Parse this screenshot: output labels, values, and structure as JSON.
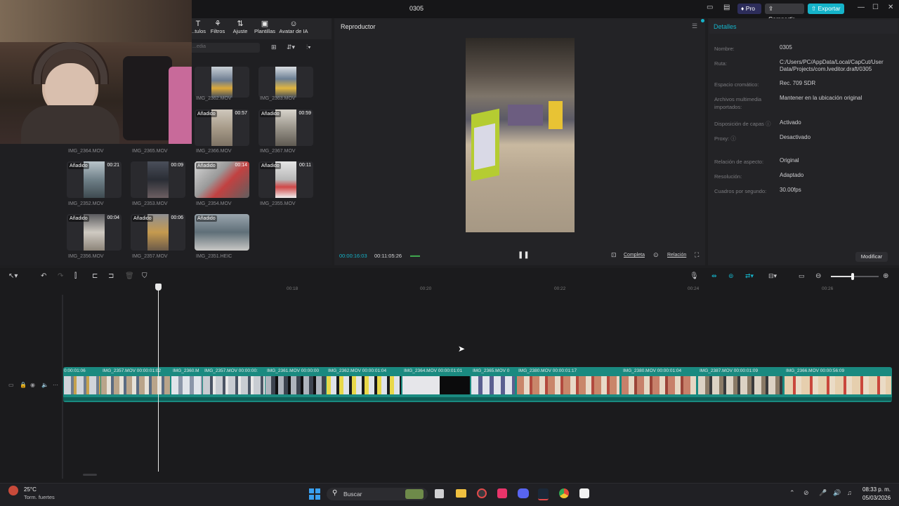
{
  "app": {
    "project_title": "0305",
    "pro_label": "Pro",
    "share_label": "Compartir",
    "export_label": "Exportar",
    "pro_color": "#2d2d5a",
    "export_color": "#15b3c9"
  },
  "media_toolbar": {
    "items": [
      {
        "label": "...tulos",
        "icon": "text-icon"
      },
      {
        "label": "Filtros",
        "icon": "filters-icon"
      },
      {
        "label": "Ajuste",
        "icon": "adjust-icon"
      },
      {
        "label": "Plantillas",
        "icon": "templates-icon"
      },
      {
        "label": "Avatar de IA",
        "icon": "ai-avatar-icon"
      }
    ],
    "search_placeholder": "...edia"
  },
  "media_items": [
    {
      "name": "IMG_2362.MOV",
      "badge": "",
      "duration": ""
    },
    {
      "name": "IMG_2363.MOV",
      "badge": "",
      "duration": ""
    },
    {
      "name": "IMG_2366.MOV",
      "badge": "Añadido",
      "duration": "00:57"
    },
    {
      "name": "IMG_2367.MOV",
      "badge": "Añadido",
      "duration": "00:59"
    },
    {
      "name": "IMG_2364.MOV",
      "badge": "",
      "duration": ""
    },
    {
      "name": "IMG_2365.MOV",
      "badge": "",
      "duration": ""
    },
    {
      "name": "IMG_2352.MOV",
      "badge": "Añadido",
      "duration": "00:21"
    },
    {
      "name": "IMG_2353.MOV",
      "badge": "",
      "duration": "00:09"
    },
    {
      "name": "IMG_2354.MOV",
      "badge": "Añadido",
      "duration": "00:14"
    },
    {
      "name": "IMG_2355.MOV",
      "badge": "Añadido",
      "duration": "00:11"
    },
    {
      "name": "IMG_2356.MOV",
      "badge": "Añadido",
      "duration": "00:04"
    },
    {
      "name": "IMG_2357.MOV",
      "badge": "Añadido",
      "duration": "00:06"
    },
    {
      "name": "IMG_2351.HEIC",
      "badge": "Añadido",
      "duration": ""
    }
  ],
  "player": {
    "title": "Reproductor",
    "current_time": "00:00:16:03",
    "total_time": "00:11:05:26",
    "full_label": "Completa",
    "ratio_label": "Relación"
  },
  "details": {
    "title": "Detalles",
    "rows": [
      {
        "label": "Nombre:",
        "value": "0305"
      },
      {
        "label": "Ruta:",
        "value": "C:/Users/PC/AppData/Local/CapCut/User Data/Projects/com.lveditor.draft/0305"
      },
      {
        "label": "Espacio cromático:",
        "value": "Rec. 709 SDR"
      },
      {
        "label": "Archivos multimedia importados:",
        "value": "Mantener en la ubicación original"
      },
      {
        "label": "Disposición de capas ⓘ",
        "value": "Activado"
      },
      {
        "label": "Proxy: ⓘ",
        "value": "Desactivado"
      },
      {
        "label": "Relación de aspecto:",
        "value": "Original"
      },
      {
        "label": "Resolución:",
        "value": "Adaptado"
      },
      {
        "label": "Cuadros por segundo:",
        "value": "30.00fps"
      }
    ],
    "modify_label": "Modificar"
  },
  "timeline": {
    "ruler": [
      "00:18",
      "00:20",
      "00:22",
      "00:24",
      "00:26"
    ],
    "clips": [
      {
        "label": "0:00:01:06"
      },
      {
        "label": "IMG_2357.MOV  00:00:01:02"
      },
      {
        "label": "IMG_2360.M"
      },
      {
        "label": "IMG_2357.MOV  00:00:00:"
      },
      {
        "label": "IMG_2361.MOV  00:00:00"
      },
      {
        "label": "IMG_2362.MOV  00:00:01:04"
      },
      {
        "label": "IMG_2364.MOV  00:00:01:01"
      },
      {
        "label": "IMG_2365.MOV  0"
      },
      {
        "label": "IMG_2380.MOV  00:00:01:17"
      },
      {
        "label": "IMG_2380.MOV  00:00:01:04"
      },
      {
        "label": "IMG_2387.MOV  00:00:01:09"
      },
      {
        "label": "IMG_2366.MOV  00:00:56:09"
      }
    ],
    "zoom_level": 0.45
  },
  "taskbar": {
    "weather_temp": "25°C",
    "weather_desc": "Torm. fuertes",
    "search_label": "Buscar",
    "time": "08:33 p. m.",
    "date": "05/03/2026"
  }
}
